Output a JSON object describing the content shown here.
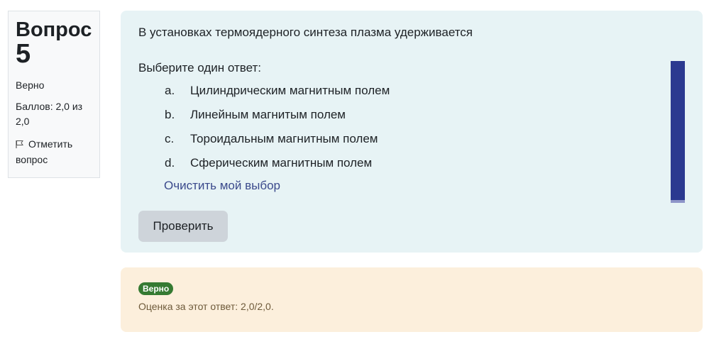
{
  "info": {
    "title": "Вопрос",
    "number": "5",
    "state": "Верно",
    "grade": "Баллов: 2,0 из 2,0",
    "flag_label": "Отметить вопрос",
    "flag_icon": "flag-icon"
  },
  "question": {
    "text": "В установках термоядерного синтеза плазма удерживается",
    "prompt": "Выберите один ответ:",
    "answers": [
      {
        "letter": "a.",
        "text": "Цилиндрическим магнитным полем"
      },
      {
        "letter": "b.",
        "text": "Линейным магнитым полем"
      },
      {
        "letter": "c.",
        "text": "Тороидальным магнитным полем"
      },
      {
        "letter": "d.",
        "text": "Сферическим магнитным полем"
      }
    ],
    "clear_label": "Очистить мой выбор",
    "check_label": "Проверить"
  },
  "outcome": {
    "badge": "Верно",
    "feedback": "Оценка за этот ответ: 2,0/2,0.",
    "badge_color": "#357a32"
  },
  "colors": {
    "question_bg": "#e7f3f5",
    "outcome_bg": "#fcefdc",
    "scrollbar": "#2b3990"
  }
}
